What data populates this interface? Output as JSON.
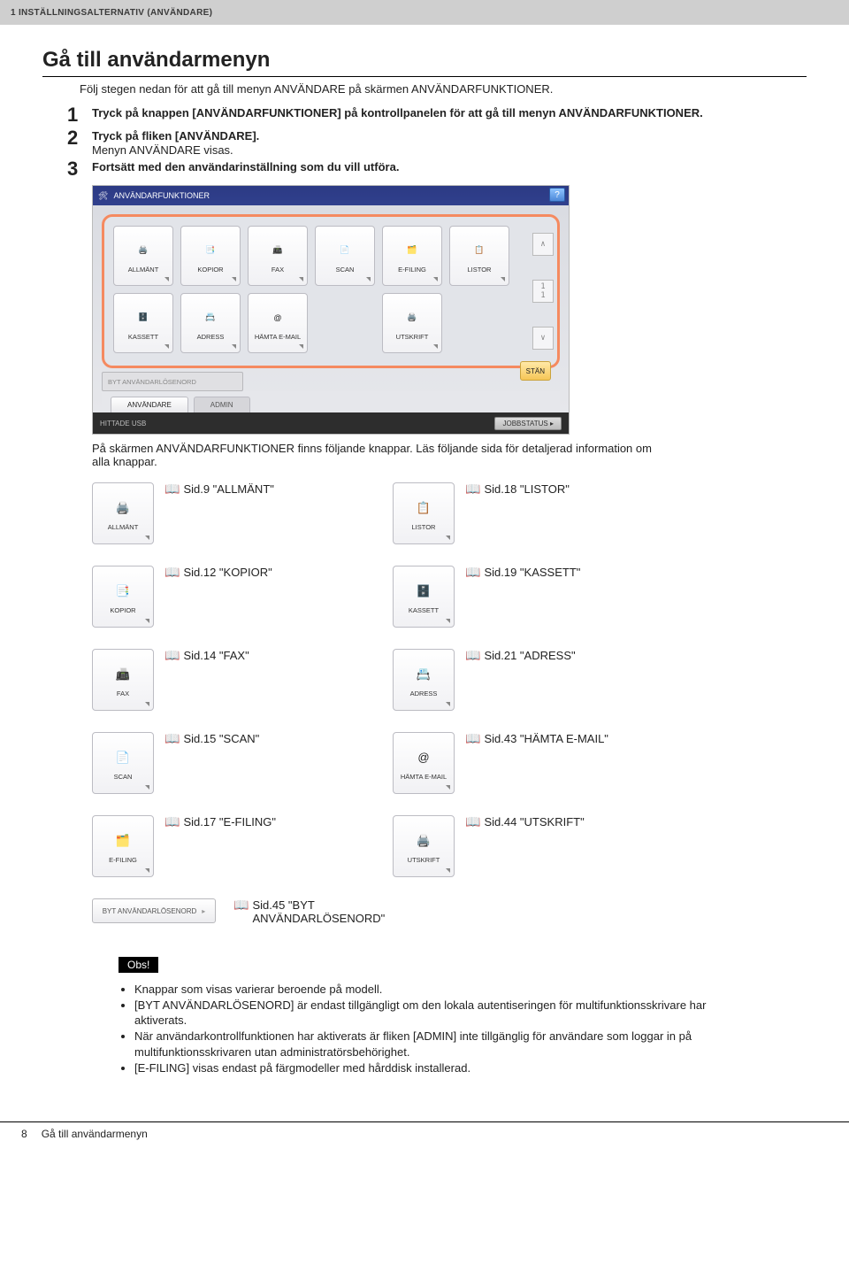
{
  "header": {
    "chapter": "1 INSTÄLLNINGSALTERNATIV (ANVÄNDARE)"
  },
  "title": "Gå till användarmenyn",
  "intro": "Följ stegen nedan för att gå till menyn ANVÄNDARE på skärmen ANVÄNDARFUNKTIONER.",
  "steps": {
    "s1": "Tryck på knappen [ANVÄNDARFUNKTIONER] på kontrollpanelen för att gå till menyn ANVÄNDARFUNKTIONER.",
    "s2a": "Tryck på fliken [ANVÄNDARE].",
    "s2b": "Menyn ANVÄNDARE visas.",
    "s3": "Fortsätt med den användarinställning som du vill utföra."
  },
  "ui": {
    "title": "ANVÄNDARFUNKTIONER",
    "tiles_r1": [
      "ALLMÄNT",
      "KOPIOR",
      "FAX",
      "SCAN",
      "E-FILING",
      "LISTOR"
    ],
    "tiles_r2": [
      "KASSETT",
      "ADRESS",
      "HÄMTA\nE-MAIL",
      "",
      "UTSKRIFT",
      ""
    ],
    "pwd": "BYT ANVÄNDARLÖSENORD",
    "stan": "STÄN",
    "tab1": "ANVÄNDARE",
    "tab2": "ADMIN",
    "usb": "HITTADE USB",
    "job": "JOBBSTATUS",
    "help": "?"
  },
  "after_ui": "På skärmen ANVÄNDARFUNKTIONER finns följande knappar. Läs följande sida för detaljerad information om alla knappar.",
  "matrix": [
    {
      "l": {
        "tile": "ALLMÄNT",
        "ref": "Sid.9 \"ALLMÄNT\""
      },
      "r": {
        "tile": "LISTOR",
        "ref": "Sid.18 \"LISTOR\""
      }
    },
    {
      "l": {
        "tile": "KOPIOR",
        "ref": "Sid.12 \"KOPIOR\""
      },
      "r": {
        "tile": "KASSETT",
        "ref": "Sid.19 \"KASSETT\""
      }
    },
    {
      "l": {
        "tile": "FAX",
        "ref": "Sid.14 \"FAX\""
      },
      "r": {
        "tile": "ADRESS",
        "ref": "Sid.21 \"ADRESS\""
      }
    },
    {
      "l": {
        "tile": "SCAN",
        "ref": "Sid.15 \"SCAN\""
      },
      "r": {
        "tile": "HÄMTA\nE-MAIL",
        "ref": "Sid.43 \"HÄMTA E-MAIL\""
      }
    },
    {
      "l": {
        "tile": "E-FILING",
        "ref": "Sid.17 \"E-FILING\""
      },
      "r": {
        "tile": "UTSKRIFT",
        "ref": "Sid.44 \"UTSKRIFT\""
      }
    }
  ],
  "pwdrow": {
    "btn": "BYT ANVÄNDARLÖSENORD",
    "ref": "Sid.45 \"BYT ANVÄNDARLÖSENORD\""
  },
  "obs": {
    "tag": "Obs!",
    "items": [
      "Knappar som visas varierar beroende på modell.",
      "[BYT ANVÄNDARLÖSENORD] är endast tillgängligt om den lokala autentiseringen för multifunktionsskrivare har aktiverats.",
      "När användarkontrollfunktionen har aktiverats är fliken [ADMIN] inte tillgänglig för användare som loggar in på multifunktionsskrivaren utan administratörsbehörighet.",
      "[E-FILING] visas endast på färgmodeller med hårddisk installerad."
    ]
  },
  "footer": {
    "pg": "8",
    "txt": "Gå till användarmenyn"
  }
}
